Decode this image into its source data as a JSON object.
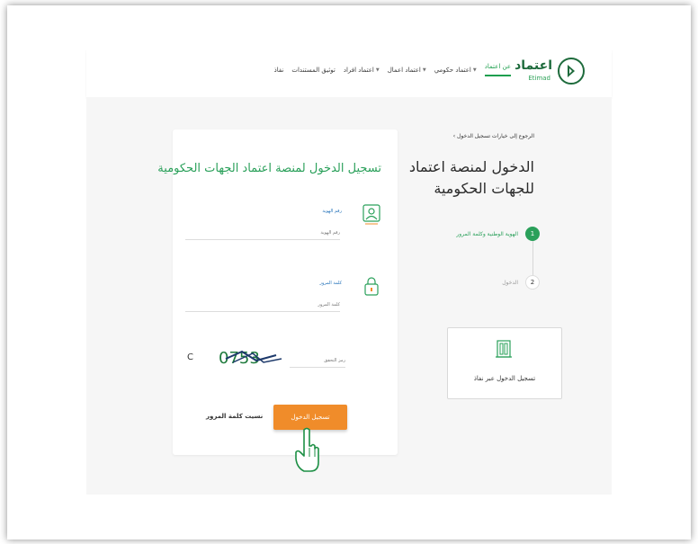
{
  "header": {
    "logo_text": "اعتماد",
    "logo_sub": "Etimad",
    "nav": [
      {
        "label": "عن اعتماد",
        "active": true,
        "dropdown": false
      },
      {
        "label": "اعتماد حكومي",
        "active": false,
        "dropdown": true
      },
      {
        "label": "اعتماد اعمال",
        "active": false,
        "dropdown": true
      },
      {
        "label": "اعتماد افراد",
        "active": false,
        "dropdown": true
      },
      {
        "label": "توثيق المستندات",
        "active": false,
        "dropdown": false
      },
      {
        "label": "نفاذ",
        "active": false,
        "dropdown": false
      }
    ]
  },
  "side": {
    "back_link": "الرجوع إلى خيارات تسجيل الدخول",
    "title": "الدخول لمنصة اعتماد للجهات الحكومية",
    "steps": [
      {
        "number": "1",
        "label": "الهوية الوطنية وكلمة المرور"
      },
      {
        "number": "2",
        "label": "الدخول"
      }
    ],
    "nafath_label": "تسجيل الدخول عبر نفاذ"
  },
  "form": {
    "title": "تسجيل الدخول لمنصة اعتماد الجهات الحكومية",
    "id_label": "رقم الهوية",
    "id_placeholder": "رقم الهوية",
    "password_label": "كلمة المرور",
    "password_placeholder": "كلمة المرور",
    "captcha_placeholder": "رمز التحقق",
    "captcha_text": "0753",
    "refresh_icon": "C",
    "login_button": "تسجيل الدخول",
    "forgot_password": "نسيت كلمة المرور"
  },
  "colors": {
    "brand_green": "#2aa05a",
    "dark_green": "#1e6b3c",
    "accent_orange": "#f08c2a",
    "link_blue": "#1f6fb8"
  }
}
